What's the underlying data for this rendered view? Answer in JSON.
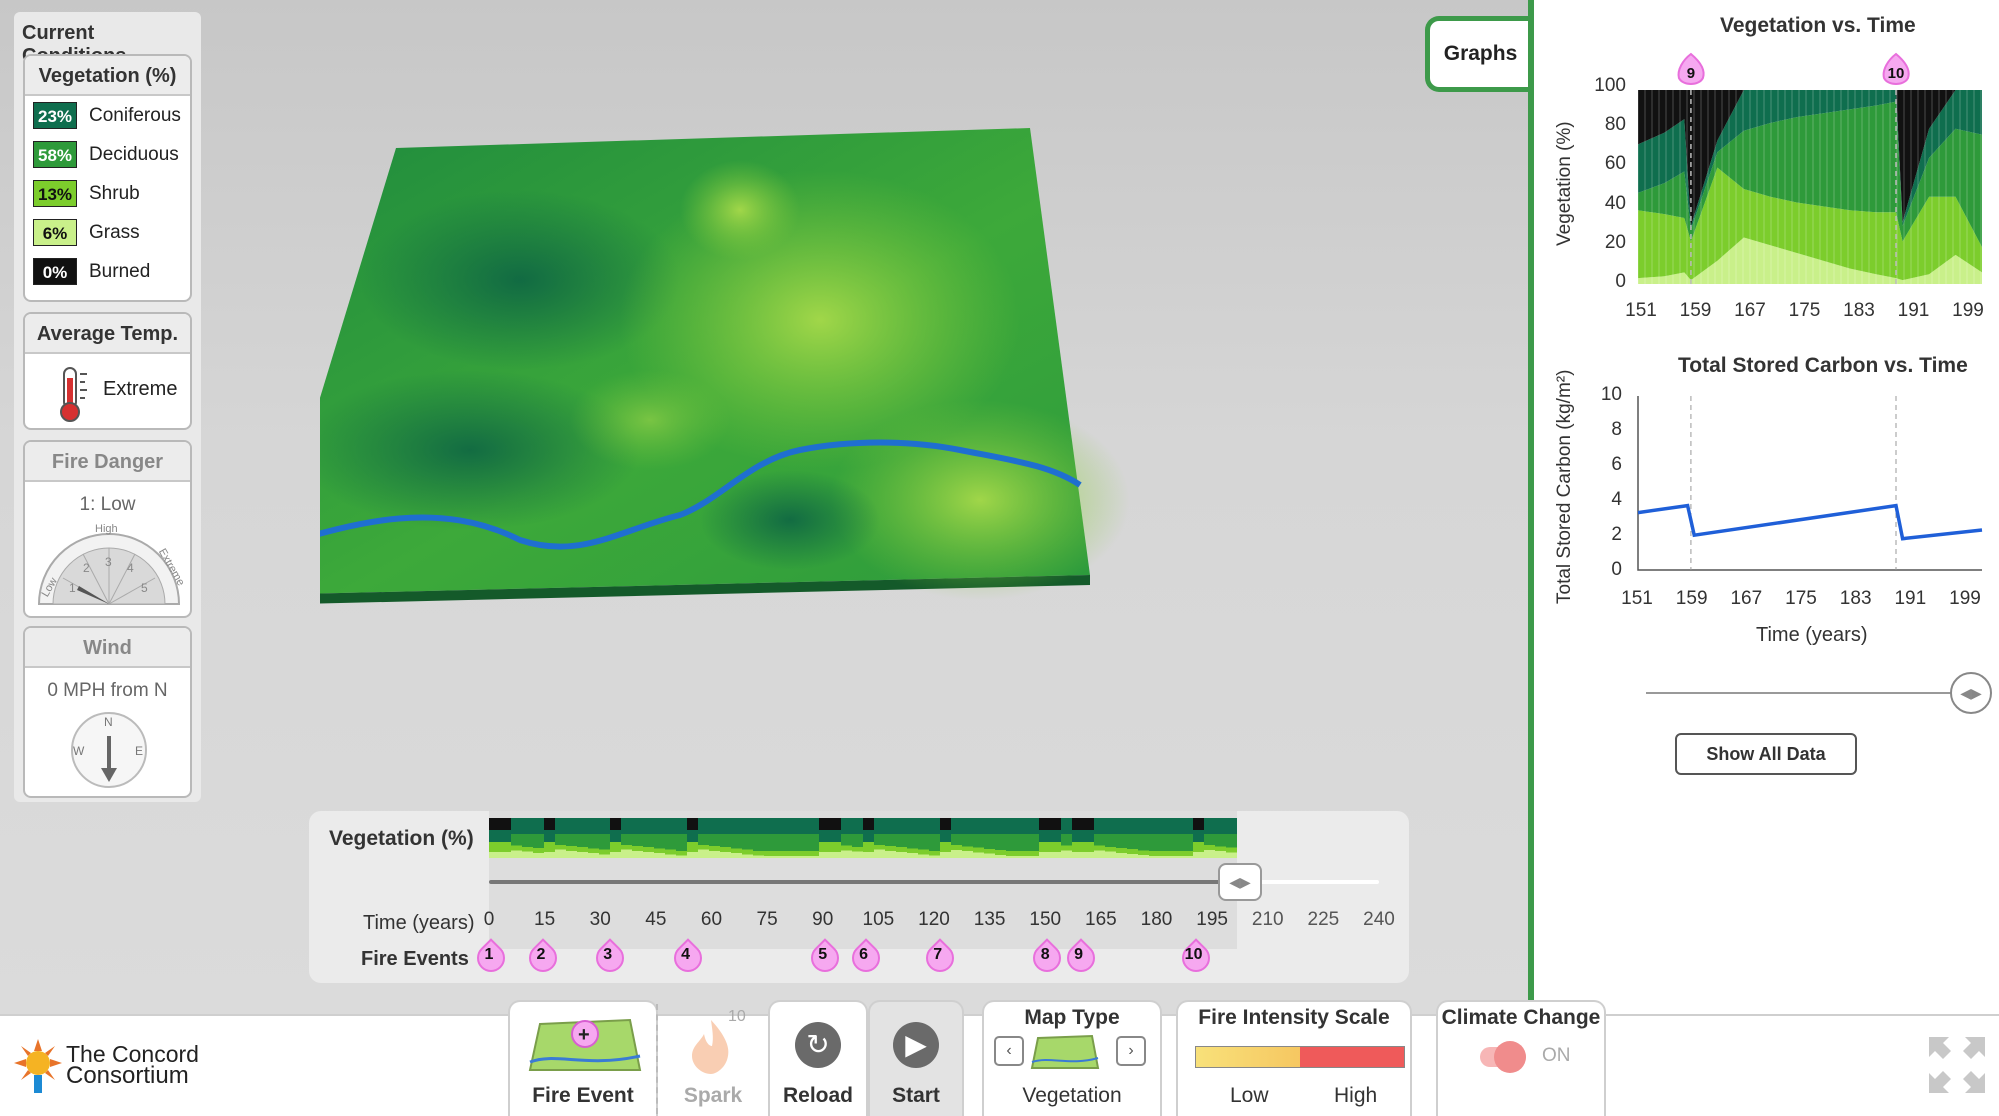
{
  "current_conditions": {
    "title": "Current Conditions",
    "vegetation": {
      "header": "Vegetation (%)",
      "items": [
        {
          "pct": "23%",
          "name": "Coniferous",
          "color": "#0f6e4e"
        },
        {
          "pct": "58%",
          "name": "Deciduous",
          "color": "#2e9a3a"
        },
        {
          "pct": "13%",
          "name": "Shrub",
          "color": "#7ccd2c"
        },
        {
          "pct": "6%",
          "name": "Grass",
          "color": "#c9f08a"
        },
        {
          "pct": "0%",
          "name": "Burned",
          "color": "#111111"
        }
      ]
    },
    "avg_temp": {
      "header": "Average Temp.",
      "value": "Extreme"
    },
    "fire_danger": {
      "header": "Fire Danger",
      "value": "1: Low",
      "gauge": {
        "top": "High",
        "left": "Low",
        "right": "Extreme",
        "n1": "1",
        "n2": "2",
        "n3": "3",
        "n4": "4",
        "n5": "5"
      }
    },
    "wind": {
      "header": "Wind",
      "value": "0 MPH from N",
      "compass": {
        "n": "N",
        "e": "E",
        "w": "W"
      }
    }
  },
  "timeline": {
    "veg_label": "Vegetation (%)",
    "time_label": "Time (years)",
    "fire_label": "Fire Events",
    "ticks": [
      "0",
      "15",
      "30",
      "45",
      "60",
      "75",
      "90",
      "105",
      "120",
      "135",
      "150",
      "165",
      "180",
      "195",
      "210",
      "225",
      "240"
    ],
    "fires": [
      {
        "num": "1",
        "year": 0
      },
      {
        "num": "2",
        "year": 14
      },
      {
        "num": "3",
        "year": 32
      },
      {
        "num": "4",
        "year": 53
      },
      {
        "num": "5",
        "year": 90
      },
      {
        "num": "6",
        "year": 101
      },
      {
        "num": "7",
        "year": 121
      },
      {
        "num": "8",
        "year": 150
      },
      {
        "num": "9",
        "year": 159
      },
      {
        "num": "10",
        "year": 190
      }
    ],
    "current_year": 203
  },
  "graphs_tab": "Graphs",
  "veg_chart": {
    "title": "Vegetation vs. Time",
    "ylabel": "Vegetation (%)",
    "y_ticks": [
      "100",
      "80",
      "60",
      "40",
      "20",
      "0"
    ],
    "x_ticks": [
      "151",
      "159",
      "167",
      "175",
      "183",
      "191",
      "199"
    ],
    "fire_markers": [
      "9",
      "10"
    ]
  },
  "chart_data": [
    {
      "type": "area",
      "title": "Vegetation vs. Time",
      "xlabel": "",
      "ylabel": "Vegetation (%)",
      "xlim": [
        151,
        203
      ],
      "ylim": [
        0,
        100
      ],
      "x": [
        151,
        155,
        158,
        159,
        163,
        167,
        171,
        175,
        179,
        183,
        187,
        190,
        191,
        195,
        199,
        203
      ],
      "series": [
        {
          "name": "Grass",
          "values": [
            3,
            4,
            6,
            2,
            12,
            24,
            20,
            16,
            12,
            8,
            5,
            3,
            2,
            5,
            15,
            6
          ]
        },
        {
          "name": "Shrub",
          "values": [
            35,
            32,
            28,
            20,
            48,
            25,
            25,
            26,
            28,
            30,
            32,
            34,
            20,
            40,
            30,
            13
          ]
        },
        {
          "name": "Deciduous",
          "values": [
            9,
            16,
            24,
            6,
            8,
            30,
            38,
            44,
            48,
            52,
            55,
            57,
            8,
            20,
            35,
            58
          ]
        },
        {
          "name": "Coniferous",
          "values": [
            25,
            26,
            27,
            2,
            6,
            21,
            17,
            14,
            12,
            10,
            8,
            6,
            2,
            15,
            20,
            23
          ]
        },
        {
          "name": "Burned",
          "values": [
            28,
            22,
            15,
            70,
            26,
            0,
            0,
            0,
            0,
            0,
            0,
            0,
            68,
            20,
            0,
            0
          ]
        }
      ]
    },
    {
      "type": "line",
      "title": "Total Stored Carbon vs. Time",
      "xlabel": "Time (years)",
      "ylabel": "Total Stored Carbon (kg/m²)",
      "xlim": [
        151,
        203
      ],
      "ylim": [
        0,
        10
      ],
      "x": [
        151,
        158.5,
        159.5,
        190,
        191,
        203
      ],
      "series": [
        {
          "name": "Total Stored Carbon",
          "values": [
            3.3,
            3.7,
            2.0,
            3.7,
            1.8,
            2.3
          ]
        }
      ]
    }
  ],
  "carbon_chart": {
    "title": "Total Stored Carbon vs. Time",
    "ylabel": "Total Stored Carbon (kg/m²)",
    "xlabel": "Time (years)",
    "y_ticks": [
      "10",
      "8",
      "6",
      "4",
      "2",
      "0"
    ],
    "x_ticks": [
      "151",
      "159",
      "167",
      "175",
      "183",
      "191",
      "199"
    ]
  },
  "show_all_data": "Show All Data",
  "toolbar": {
    "logo_line1": "The Concord",
    "logo_line2": "Consortium",
    "fire_event": "Fire Event",
    "spark": "Spark",
    "spark_count": "10",
    "reload": "Reload",
    "start": "Start",
    "map_type_title": "Map Type",
    "map_type_value": "Vegetation",
    "intensity_title": "Fire Intensity Scale",
    "intensity_low": "Low",
    "intensity_high": "High",
    "climate_title": "Climate Change",
    "climate_state": "ON"
  }
}
